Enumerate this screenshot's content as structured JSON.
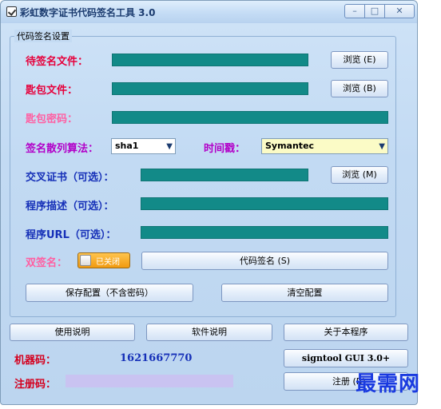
{
  "window": {
    "title": "彩虹数字证书代码签名工具 3.0",
    "controls": {
      "minimize": "–",
      "maximize": "□",
      "close": "✕"
    }
  },
  "settings_group": {
    "title": "代码签名设置",
    "pending_file": {
      "label": "待签名文件：",
      "value": "",
      "browse": "浏览 (E)"
    },
    "pfx_file": {
      "label": "匙包文件：",
      "value": "",
      "browse": "浏览 (B)"
    },
    "pfx_password": {
      "label": "匙包密码：",
      "value": ""
    },
    "hash_algorithm": {
      "label": "签名散列算法：",
      "selected": "sha1"
    },
    "timestamp": {
      "label": "时间戳：",
      "selected": "Symantec"
    },
    "cross_cert": {
      "label": "交叉证书（可选）：",
      "value": "",
      "browse": "浏览 (M)"
    },
    "description": {
      "label": "程序描述（可选）：",
      "value": ""
    },
    "program_url": {
      "label": "程序URL（可选）：",
      "value": ""
    },
    "dual_sign": {
      "label": "双签名：",
      "toggle_text": "已关闭",
      "enabled": false
    },
    "sign_button": "代码签名 (S)",
    "save_config": "保存配置（不含密码）",
    "clear_config": "清空配置"
  },
  "bottom": {
    "usage_button": "使用说明",
    "software_button": "软件说明",
    "about_button": "关于本程序",
    "machine_code_label": "机器码：",
    "machine_code": "1621667770",
    "gui_button": "signtool GUI 3.0+",
    "reg_code_label": "注册码：",
    "reg_code": "",
    "register_button": "注册 (R)"
  },
  "watermark": "最需网",
  "colors": {
    "field_teal": "#128a88",
    "label_red": "#e6003b",
    "label_pink": "#ff5fa2",
    "label_purple": "#b200c8",
    "label_blue": "#1630b8",
    "toggle_orange": "#f19a10",
    "reg_field_lavender": "#c9c3f1"
  },
  "icons": {
    "app": "checkbox-icon",
    "minimize": "minimize-icon",
    "maximize": "maximize-icon",
    "close": "close-icon",
    "dropdown": "chevron-down-icon"
  }
}
